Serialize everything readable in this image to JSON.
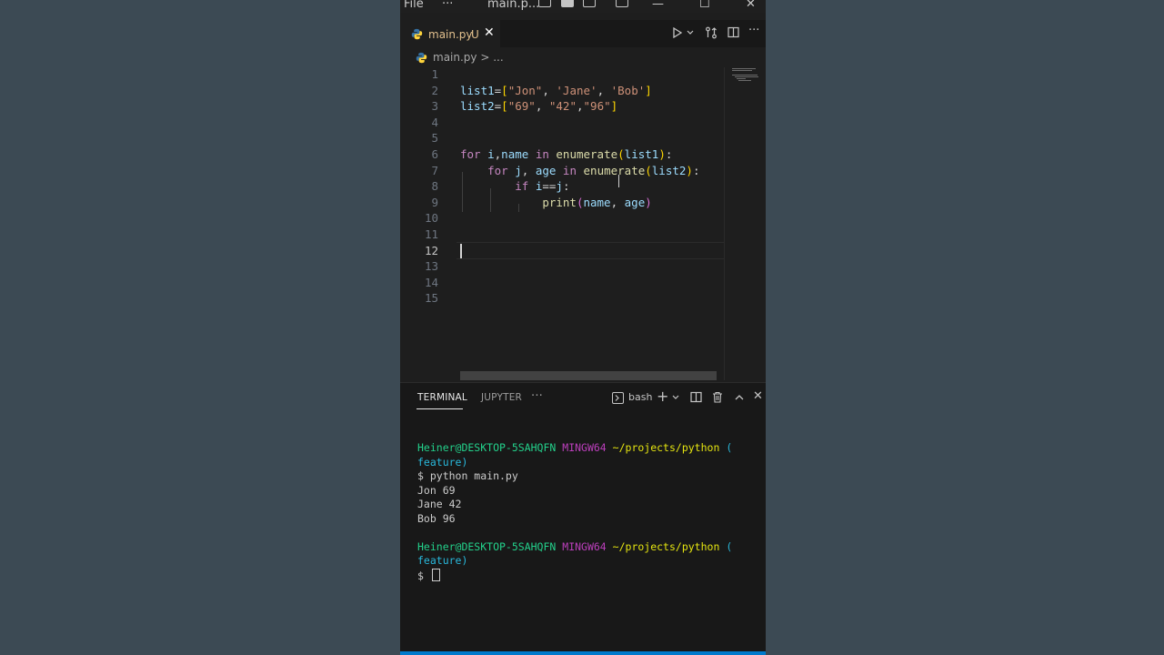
{
  "titlebar": {
    "menu_file": "File",
    "menu_more": "···",
    "title": "main.p...",
    "min": "—",
    "max": "☐",
    "close": "✕"
  },
  "tab": {
    "filename": "main.py",
    "status": "U",
    "close": "✕"
  },
  "breadcrumb": {
    "text": "main.py > ..."
  },
  "editor": {
    "active_line": 12,
    "line_numbers": [
      "1",
      "2",
      "3",
      "4",
      "5",
      "6",
      "7",
      "8",
      "9",
      "10",
      "11",
      "12",
      "13",
      "14",
      "15"
    ]
  },
  "panel": {
    "tab_terminal": "TERMINAL",
    "tab_jupyter": "JUPYTER",
    "more": "···",
    "shell": "bash"
  },
  "terminal": {
    "user_host": "Heiner@DESKTOP-5SAHQFN",
    "shell_env": "MINGW64",
    "path": "~/projects/python",
    "branch_open": "(",
    "branch": "feature)",
    "command": "$ python main.py",
    "output": [
      "Jon 69",
      "Jane 42",
      "Bob 96"
    ],
    "prompt": "$"
  },
  "colors": {
    "background": "#3c4a54",
    "editor_bg": "#1e1e1e",
    "accent": "#007acc"
  }
}
